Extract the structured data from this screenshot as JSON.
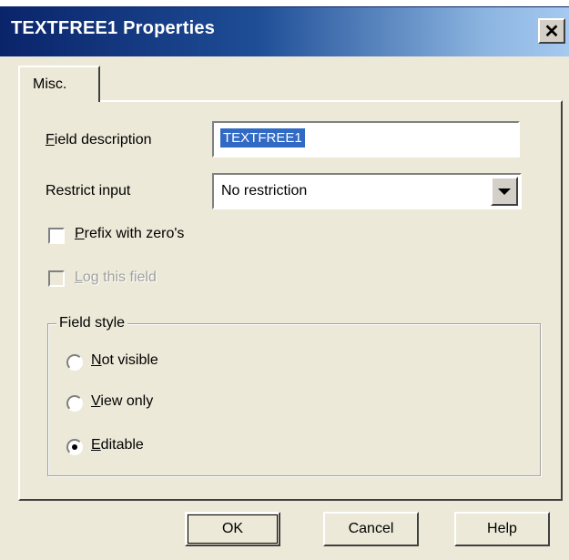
{
  "window": {
    "title": "TEXTFREE1 Properties",
    "close_glyph": "✕"
  },
  "tabs": [
    {
      "label": "Misc.",
      "active": true
    }
  ],
  "form": {
    "field_description": {
      "label_accel": "F",
      "label_rest": "ield description",
      "value": "TEXTFREE1"
    },
    "restrict_input": {
      "label": "Restrict input",
      "value": "No restriction"
    },
    "prefix_zeros": {
      "label_accel": "P",
      "label_rest": "refix with zero's",
      "checked": false
    },
    "log_field": {
      "label_accel": "L",
      "label_rest": "og this field",
      "checked": false,
      "disabled": true
    }
  },
  "field_style": {
    "legend": "Field style",
    "options": [
      {
        "accel": "N",
        "rest": "ot visible",
        "selected": false
      },
      {
        "accel": "V",
        "rest": "iew only",
        "selected": false
      },
      {
        "accel": "E",
        "rest": "ditable",
        "selected": true
      }
    ]
  },
  "buttons": {
    "ok": "OK",
    "cancel": "Cancel",
    "help": "Help"
  },
  "colors": {
    "title_bar": "#0a246a",
    "selection": "#316ac5",
    "dialog_bg": "#ece9d8"
  }
}
